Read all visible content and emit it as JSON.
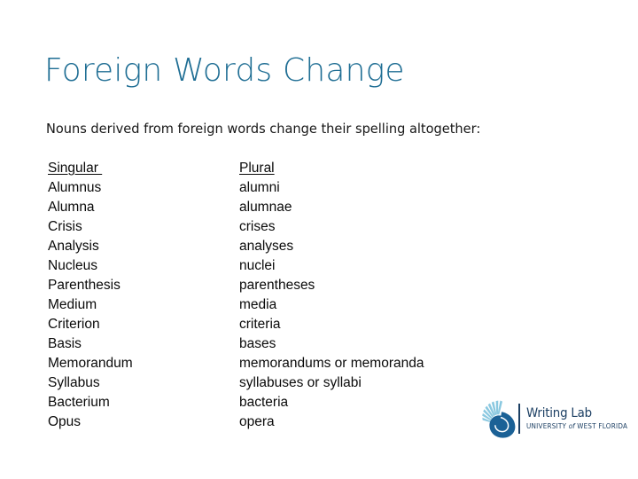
{
  "slide": {
    "title": "Foreign Words Change",
    "subtitle": "Nouns derived from foreign words change their spelling altogether:",
    "colors": {
      "title_blue": "#1f6e94",
      "body_black": "#0a0a0a",
      "logo_navy": "#1c3f63",
      "logo_shell_dark": "#1b5f92",
      "logo_shell_light": "#7fc2de",
      "background": "#ffffff"
    },
    "table": {
      "headers": {
        "singular": "Singular ",
        "plural": "Plural"
      },
      "rows": [
        {
          "singular": "Alumnus",
          "plural": "alumni"
        },
        {
          "singular": "Alumna",
          "plural": "alumnae"
        },
        {
          "singular": "Crisis",
          "plural": "crises"
        },
        {
          "singular": "Analysis",
          "plural": "analyses"
        },
        {
          "singular": "Nucleus",
          "plural": "nuclei"
        },
        {
          "singular": "Parenthesis",
          "plural": "parentheses"
        },
        {
          "singular": "Medium",
          "plural": "media"
        },
        {
          "singular": "Criterion",
          "plural": "criteria"
        },
        {
          "singular": "Basis",
          "plural": "bases"
        },
        {
          "singular": "Memorandum",
          "plural": "memorandums or memoranda"
        },
        {
          "singular": "Syllabus",
          "plural": "syllabuses or syllabi"
        },
        {
          "singular": "Bacterium",
          "plural": "bacteria"
        },
        {
          "singular": "Opus",
          "plural": "opera"
        }
      ]
    },
    "logo": {
      "mark_icon": "nautilus-shell-icon",
      "name": "Writing Lab",
      "tagline_prefix": "UNIVERSITY",
      "tagline_of": "of",
      "tagline_suffix": "WEST FLORIDA"
    }
  }
}
